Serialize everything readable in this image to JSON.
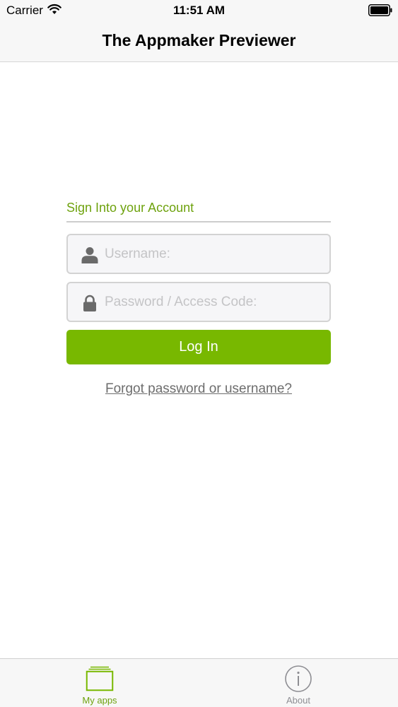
{
  "status_bar": {
    "carrier": "Carrier",
    "time": "11:51 AM",
    "wifi_icon": "wifi-icon",
    "battery_icon": "battery-icon"
  },
  "nav": {
    "title": "The Appmaker Previewer"
  },
  "login": {
    "header": "Sign Into your Account",
    "username": {
      "placeholder": "Username:",
      "value": "",
      "icon": "user-icon"
    },
    "password": {
      "placeholder": "Password / Access Code:",
      "value": "",
      "icon": "lock-icon"
    },
    "button_label": "Log In",
    "forgot_link": "Forgot password or username?"
  },
  "tab_bar": {
    "tabs": [
      {
        "label": "My apps",
        "icon": "stacked-folders-icon",
        "selected": true
      },
      {
        "label": "About",
        "icon": "info-icon",
        "selected": false
      }
    ]
  },
  "colors": {
    "accent": "#78b800",
    "header_text": "#6ea20e",
    "link_text": "#6d6d6d",
    "field_border": "#d3d3d3",
    "bar_background": "#f7f7f7"
  }
}
